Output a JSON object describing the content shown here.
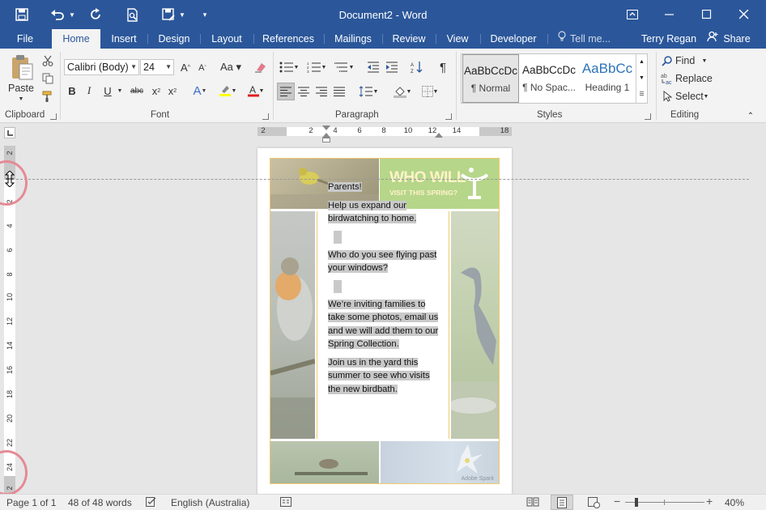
{
  "titlebar": {
    "title": "Document2 - Word",
    "qat_icons": [
      "save-icon",
      "undo-icon",
      "undo-dropdown-icon",
      "redo-icon",
      "print-preview-icon",
      "save-as-icon",
      "save-as-dropdown-icon",
      "customize-qat-icon"
    ],
    "window_buttons": [
      "ribbon-display-icon",
      "minimize-icon",
      "maximize-icon",
      "close-icon"
    ]
  },
  "tabs": {
    "file": "File",
    "home": "Home",
    "insert": "Insert",
    "design": "Design",
    "layout": "Layout",
    "references": "References",
    "mailings": "Mailings",
    "review": "Review",
    "view": "View",
    "developer": "Developer",
    "tell_me": "Tell me...",
    "user": "Terry Regan",
    "share": "Share"
  },
  "ribbon": {
    "clipboard": {
      "label": "Clipboard",
      "paste": "Paste"
    },
    "font": {
      "label": "Font",
      "font_name": "Calibri (Body)",
      "font_size": "24"
    },
    "paragraph": {
      "label": "Paragraph"
    },
    "styles": {
      "label": "Styles",
      "items": [
        {
          "preview": "AaBbCcDc",
          "name": "¶ Normal"
        },
        {
          "preview": "AaBbCcDc",
          "name": "¶ No Spac..."
        },
        {
          "preview": "AaBbCc",
          "name": "Heading 1"
        }
      ]
    },
    "editing": {
      "label": "Editing",
      "find": "Find",
      "replace": "Replace",
      "select": "Select"
    }
  },
  "ruler": {
    "horizontal": [
      "2",
      "2",
      "4",
      "6",
      "8",
      "10",
      "12",
      "14",
      "18"
    ],
    "vertical": [
      "2",
      "2",
      "4",
      "6",
      "8",
      "10",
      "12",
      "14",
      "16",
      "18",
      "20",
      "22",
      "24",
      "2"
    ]
  },
  "document": {
    "banner_line1": "WHO WILL",
    "banner_line2": "VISIT THIS SPRING?",
    "watermark": "Adobe Spark",
    "paragraphs": [
      "Parents!",
      "Help us expand our birdwatching to home.",
      "",
      "Who do you see flying past your windows?",
      "",
      "We’re inviting families to take some photos, email us and we will add them to our Spring Collection.",
      "Join us in the yard this summer to see who visits the new birdbath."
    ]
  },
  "statusbar": {
    "page": "Page 1 of 1",
    "words": "48 of 48 words",
    "language": "English (Australia)",
    "zoom": "40%"
  },
  "colors": {
    "accent": "#2b579a",
    "selection": "#c9c9c9",
    "highlight_circle": "#e58a96",
    "banner_green": "#b6d68a"
  }
}
